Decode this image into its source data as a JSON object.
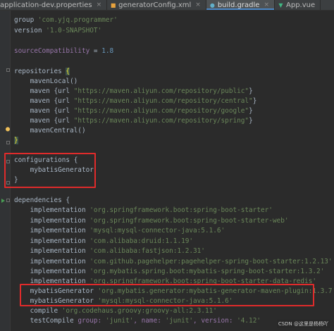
{
  "tabs": [
    {
      "label": "application-dev.properties",
      "icon": "properties-file-icon",
      "active": false
    },
    {
      "label": "generatorConfig.xml",
      "icon": "xml-file-icon",
      "active": false
    },
    {
      "label": "build.gradle",
      "icon": "gradle-file-icon",
      "active": true
    },
    {
      "label": "App.vue",
      "icon": "vue-file-icon",
      "active": false
    }
  ],
  "tab_close_glyph": "×",
  "code": {
    "group_kw": "group",
    "group_val": "'com.yjq.programmer'",
    "version_kw": "version",
    "version_val": "'1.0-SNAPSHOT'",
    "source_compat_kw": "sourceCompatibility",
    "source_compat_eq": " = ",
    "source_compat_val": "1.8",
    "repositories_kw": "repositories",
    "open_brace": "{",
    "close_brace": "}",
    "maven_local": "mavenLocal()",
    "maven_kw": "maven",
    "url_open": "{url ",
    "url_close": "}",
    "repo_urls": [
      "\"https://maven.aliyun.com/repository/public\"",
      "\"https://maven.aliyun.com/repository/central\"",
      "\"https://maven.aliyun.com/repository/google\"",
      "\"https://maven.aliyun.com/repository/spring\""
    ],
    "maven_central": "mavenCentral()",
    "configurations_kw": "configurations",
    "mybatis_generator_cfg": "mybatisGenerator",
    "dependencies_kw": "dependencies",
    "implementation_kw": "implementation",
    "implementations": [
      "'org.springframework.boot:spring-boot-starter'",
      "'org.springframework.boot:spring-boot-starter-web'",
      "'mysql:mysql-connector-java:5.1.6'",
      "'com.alibaba:druid:1.1.19'",
      "'com.alibaba:fastjson:1.2.31'",
      "'com.github.pagehelper:pagehelper-spring-boot-starter:1.2.13'",
      "'org.mybatis.spring.boot:mybatis-spring-boot-starter:1.3.2'",
      "'org.springframework.boot:spring-boot-starter-data-redis'"
    ],
    "mybatis_generator_kw": "mybatisGenerator",
    "mybatis_generator_deps": [
      "'org.mybatis.generator:mybatis-generator-maven-plugin:1.3.7'",
      "'mysql:mysql-connector-java:5.1.6'"
    ],
    "compile_kw": "compile",
    "compile_val": "'org.codehaus.groovy:groovy-all:2.3.11'",
    "test_compile_kw": "testCompile",
    "tc_group_label": "group: ",
    "tc_group_val": "'junit'",
    "tc_name_label": ", name: ",
    "tc_name_val": "'junit'",
    "tc_version_label": ", version: ",
    "tc_version_val": "'4.12'"
  },
  "watermark": "CSDN @这里是杨杨吖",
  "colors": {
    "background": "#2b2b2b",
    "string": "#6a8759",
    "number": "#6897bb",
    "default_text": "#a9b7c6",
    "highlight_box": "#e02b2b"
  }
}
